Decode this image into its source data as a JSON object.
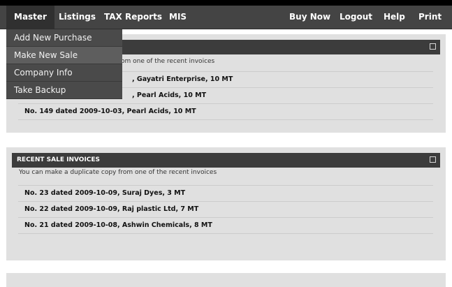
{
  "nav": {
    "left": [
      "Master",
      "Listings",
      "TAX Reports",
      "MIS"
    ],
    "right": [
      "Buy Now",
      "Logout",
      "Help",
      "Print"
    ]
  },
  "dropdown": [
    "Add New Purchase",
    "Make New Sale",
    "Company Info",
    "Take Backup"
  ],
  "purchase_panel": {
    "subtitle_partial": "om one of the recent invoices",
    "rows": [
      ", Gayatri Enterprise, 10 MT",
      ", Pearl Acids, 10 MT",
      "No. 149 dated 2009-10-03, Pearl Acids, 10 MT"
    ]
  },
  "sale_panel": {
    "title": "RECENT SALE INVOICES",
    "subtitle": "You can make a duplicate copy from one of the recent invoices",
    "rows": [
      "No. 23 dated 2009-10-09, Suraj Dyes, 3 MT",
      "No. 22 dated 2009-10-09, Raj plastic Ltd, 7 MT",
      "No. 21 dated 2009-10-08, Ashwin Chemicals, 8 MT"
    ]
  }
}
